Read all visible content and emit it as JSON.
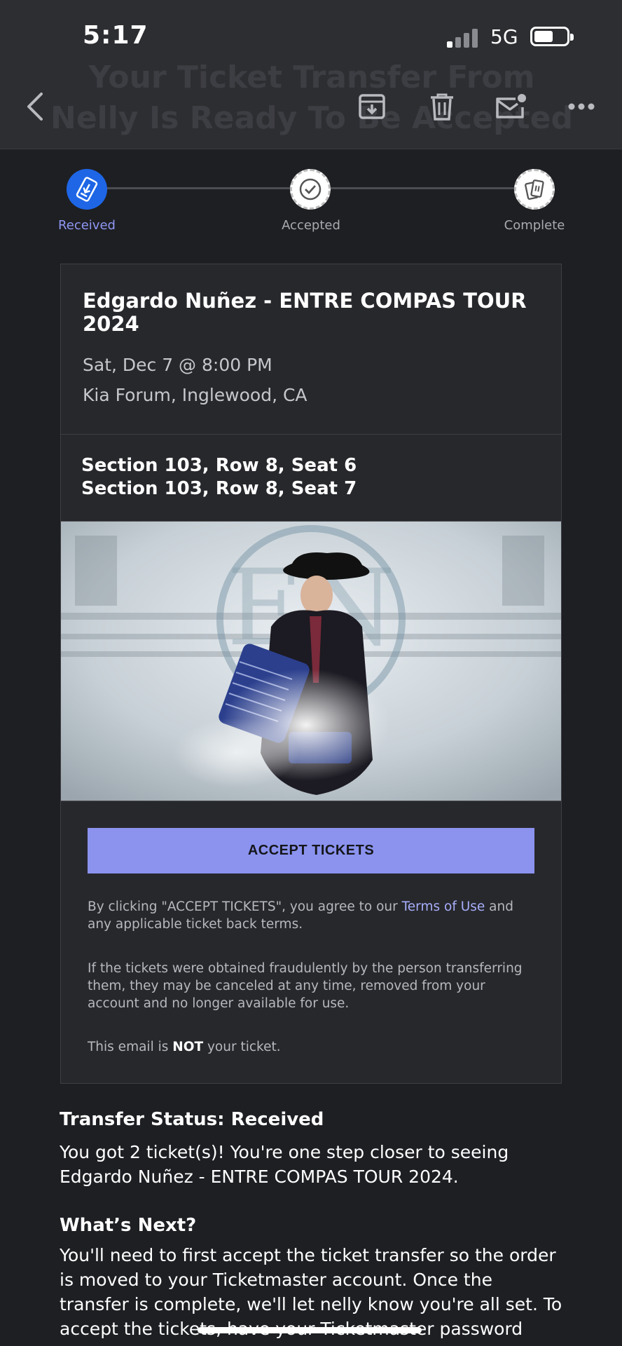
{
  "status_bar": {
    "time": "5:17",
    "network": "5G"
  },
  "header": {
    "ghost_title": "Your Ticket Transfer From Nelly Is Ready To Be Accepted",
    "back_icon": "chevron-left-icon",
    "actions": [
      "archive-icon",
      "trash-icon",
      "mail-icon",
      "more-icon"
    ]
  },
  "progress": {
    "steps": [
      {
        "label": "Received",
        "icon": "ticket-download-icon"
      },
      {
        "label": "Accepted",
        "icon": "check-circle-icon"
      },
      {
        "label": "Complete",
        "icon": "tickets-icon"
      }
    ],
    "active_color": "#1e66e6",
    "active_label_color": "#8f98f3"
  },
  "event": {
    "title": "Edgardo Nuñez - ENTRE COMPAS TOUR 2024",
    "date": "Sat, Dec 7 @ 8:00 PM",
    "venue": "Kia Forum, Inglewood, CA",
    "seats": [
      "Section 103, Row 8, Seat 6",
      "Section 103, Row 8, Seat 7"
    ]
  },
  "accept": {
    "button_label": "ACCEPT TICKETS",
    "button_color": "#8b93ef"
  },
  "fine_print": {
    "p1_before": "By clicking \"ACCEPT TICKETS\", you agree to our ",
    "p1_link": "Terms of Use",
    "p1_after": " and any applicable ticket back terms.",
    "p2": "If the tickets were obtained fraudulently by the person transferring them, they may be canceled at any time, removed from your account and no longer available for use.",
    "p3_before": "This email is ",
    "p3_strong": "NOT",
    "p3_after": " your ticket."
  },
  "transfer_status": {
    "title": "Transfer Status: Received",
    "text": "You got 2 ticket(s)! You're one step closer to seeing Edgardo Nuñez - ENTRE COMPAS TOUR 2024."
  },
  "whats_next": {
    "title": "What’s Next?",
    "text": "You'll need to first accept the ticket transfer so the order is moved to your Ticketmaster account. Once the transfer is complete, we'll let nelly know you're all set. To accept the tickets, have your Ticketmaster password handy and login"
  }
}
